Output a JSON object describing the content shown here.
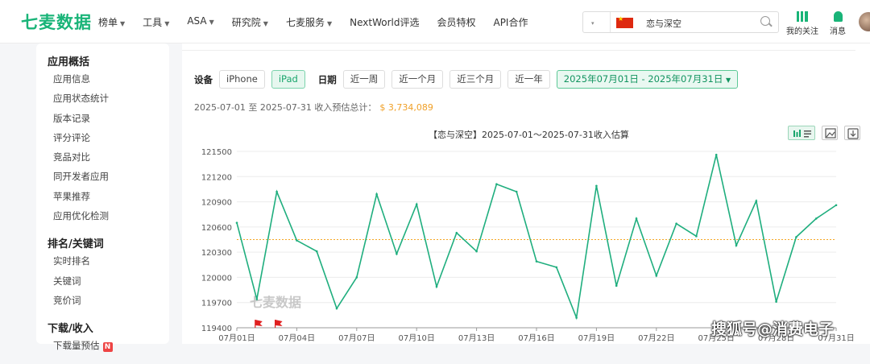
{
  "header": {
    "logo": "七麦数据",
    "nav": [
      {
        "label": "榜单",
        "dropdown": true
      },
      {
        "label": "工具",
        "dropdown": true
      },
      {
        "label": "ASA",
        "dropdown": true
      },
      {
        "label": "研究院",
        "dropdown": true
      },
      {
        "label": "七麦服务",
        "dropdown": true
      },
      {
        "label": "NextWorld评选",
        "dropdown": false
      },
      {
        "label": "会员特权",
        "dropdown": false
      },
      {
        "label": "API合作",
        "dropdown": false
      }
    ],
    "search_value": "恋与深空",
    "my_follow": "我的关注",
    "messages": "消息"
  },
  "sidebar": {
    "groups": [
      {
        "title": "应用概括",
        "items": [
          "应用信息",
          "应用状态统计",
          "版本记录",
          "评分评论",
          "竞品对比",
          "同开发者应用",
          "苹果推荐",
          "应用优化检测"
        ]
      },
      {
        "title": "排名/关键词",
        "items": [
          "实时排名",
          "关键词",
          "竞价词"
        ]
      },
      {
        "title": "下载/收入",
        "items": [
          "下载量预估"
        ]
      }
    ],
    "new_badge": "N"
  },
  "filters": {
    "device_label": "设备",
    "devices": [
      "iPhone",
      "iPad"
    ],
    "active_device": "iPad",
    "date_label": "日期",
    "ranges": [
      "近一周",
      "近一个月",
      "近三个月",
      "近一年"
    ],
    "date_range": "2025年07月01日 - 2025年07月31日"
  },
  "summary": {
    "text": "2025-07-01 至 2025-07-31 收入预估总计：",
    "amount": "$ 3,734,089"
  },
  "chart_data": {
    "type": "line",
    "title": "【恋与深空】2025-07-01～2025-07-31收入估算",
    "x": [
      "07月01日",
      "07月02日",
      "07月03日",
      "07月04日",
      "07月05日",
      "07月06日",
      "07月07日",
      "07月08日",
      "07月09日",
      "07月10日",
      "07月11日",
      "07月12日",
      "07月13日",
      "07月14日",
      "07月15日",
      "07月16日",
      "07月17日",
      "07月18日",
      "07月19日",
      "07月20日",
      "07月21日",
      "07月22日",
      "07月23日",
      "07月24日",
      "07月25日",
      "07月26日",
      "07月27日",
      "07月28日",
      "07月29日",
      "07月30日",
      "07月31日"
    ],
    "x_tick_labels": [
      "07月01日",
      "07月04日",
      "07月07日",
      "07月10日",
      "07月13日",
      "07月16日",
      "07月19日",
      "07月22日",
      "07月25日",
      "07月28日",
      "07月31日"
    ],
    "values": [
      120650,
      119740,
      121020,
      120440,
      120310,
      119630,
      120000,
      120990,
      120280,
      120870,
      119890,
      120530,
      120310,
      121110,
      121020,
      120190,
      120120,
      119520,
      121090,
      119900,
      120700,
      120020,
      120640,
      120490,
      121460,
      120380,
      120910,
      119710,
      120480,
      120700,
      120860
    ],
    "ylim": [
      119400,
      121500
    ],
    "yticks": [
      119400,
      119700,
      120000,
      120300,
      120600,
      120900,
      121200,
      121500
    ],
    "average": 120450,
    "grid": true,
    "color": "#1fae7e",
    "average_color": "#f5a623",
    "flag_days": [
      2,
      3
    ],
    "watermark": "七麦数据"
  },
  "overlay_watermark": "搜狐号@消费电子"
}
